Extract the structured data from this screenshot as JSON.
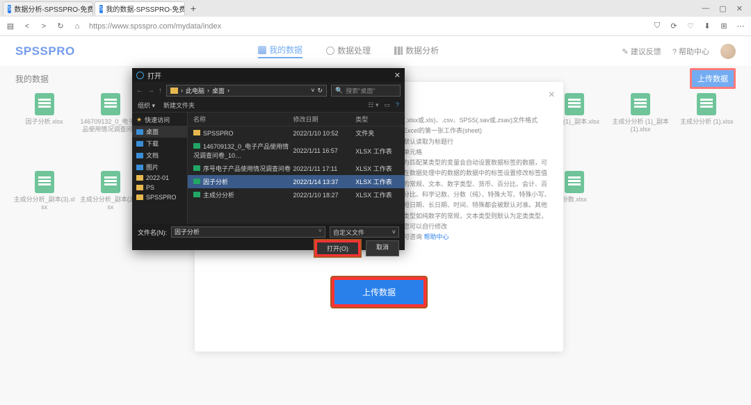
{
  "browser": {
    "tabs": [
      {
        "label": "数据分析-SPSSPRO-免费专业的",
        "fav": "S"
      },
      {
        "label": "我的数据-SPSSPRO-免费专业的",
        "fav": "S"
      }
    ],
    "url": "https://www.spsspro.com/mydata/index",
    "winctl": {
      "min": "—",
      "max": "▢",
      "close": "✕"
    }
  },
  "site": {
    "logo": "SPSSPRO",
    "nav": [
      {
        "label": "我的数据",
        "active": true
      },
      {
        "label": "数据处理",
        "active": false
      },
      {
        "label": "数据分析",
        "active": false
      }
    ],
    "right": [
      {
        "label": "建议反馈"
      },
      {
        "label": "帮助中心"
      }
    ],
    "subtitle": "我的数据",
    "upload_badge": "上传数据"
  },
  "files_row1": [
    {
      "name": "因子分析.xlsx"
    },
    {
      "name": "146709132_0_电子产品使用情况调查问卷"
    },
    {
      "name": ""
    },
    {
      "name": ""
    },
    {
      "name": ""
    },
    {
      "name": ""
    },
    {
      "name": ""
    },
    {
      "name": ""
    },
    {
      "name": "分析 (1)_副本.xlsx"
    },
    {
      "name": "主成分分析 (1)_副本 (1).xlsx"
    },
    {
      "name": "主成分分析 (1).xlsx"
    }
  ],
  "files_row2": [
    {
      "name": "主成分分析_副本(3).xlsx"
    },
    {
      "name": "主成分分析_副本(2).xlsx"
    },
    {
      "name": ""
    },
    {
      "name": ""
    },
    {
      "name": ""
    },
    {
      "name": ""
    },
    {
      "name": ""
    },
    {
      "name": ""
    },
    {
      "name": "份数.xlsx"
    },
    {
      "name": ""
    },
    {
      "name": ""
    }
  ],
  "modal": {
    "tips": [
      "(.xlsx或.xls)、.csv、SPSS(.sav或.zsav)文件格式",
      "Excel的第一张工作表(sheet)",
      "默认读取为标题行",
      "单元格",
      "为匹配某类型的变量会自动设置数据标签的数据，可在数据处理中的数据的数据中的标签设置修改标签值",
      "的常规、文本、数字类型、货币、百分比、会计、百分比、科学记数、分数（纯）、特殊大写、特殊小写、短日期、长日期、时间、特殊都会被默认对准。其他类型如纯数字的常规，文本类型则默认为定类类型，您可以自行修改",
      "可咨询 帮助中心"
    ],
    "help_link": "帮助中心",
    "button": "上传数据"
  },
  "osdialog": {
    "title": "打开",
    "path": [
      "此电脑",
      "桌面"
    ],
    "search_ph": "搜索\"桌面\"",
    "toolbar": {
      "org": "组织 ▾",
      "newf": "新建文件夹"
    },
    "side": [
      {
        "label": "快速访问",
        "type": "star"
      },
      {
        "label": "桌面",
        "type": "blue",
        "sel": true
      },
      {
        "label": "下载",
        "type": "blue"
      },
      {
        "label": "文档",
        "type": "blue"
      },
      {
        "label": "图片",
        "type": "blue"
      },
      {
        "label": "2022-01",
        "type": "fold"
      },
      {
        "label": "PS",
        "type": "fold"
      },
      {
        "label": "SPSSPRO",
        "type": "fold"
      }
    ],
    "headers": {
      "name": "名称",
      "date": "修改日期",
      "type": "类型"
    },
    "rows": [
      {
        "ico": "fold",
        "name": "SPSSPRO",
        "date": "2022/1/10 10:52",
        "type": "文件夹"
      },
      {
        "ico": "xls",
        "name": "146709132_0_电子产品使用情况调查问卷_10…",
        "date": "2022/1/11 16:57",
        "type": "XLSX 工作表"
      },
      {
        "ico": "xls",
        "name": "序号电子产品使用情况调查问卷",
        "date": "2022/1/11 17:11",
        "type": "XLSX 工作表"
      },
      {
        "ico": "xls",
        "name": "因子分析",
        "date": "2022/1/14 13:37",
        "type": "XLSX 工作表",
        "sel": true
      },
      {
        "ico": "xls",
        "name": "主成分分析",
        "date": "2022/1/10 18:27",
        "type": "XLSX 工作表"
      }
    ],
    "fn_label": "文件名(N):",
    "fn_value": "因子分析",
    "filter": "自定义文件",
    "open_btn": "打开(O)",
    "cancel_btn": "取消"
  }
}
